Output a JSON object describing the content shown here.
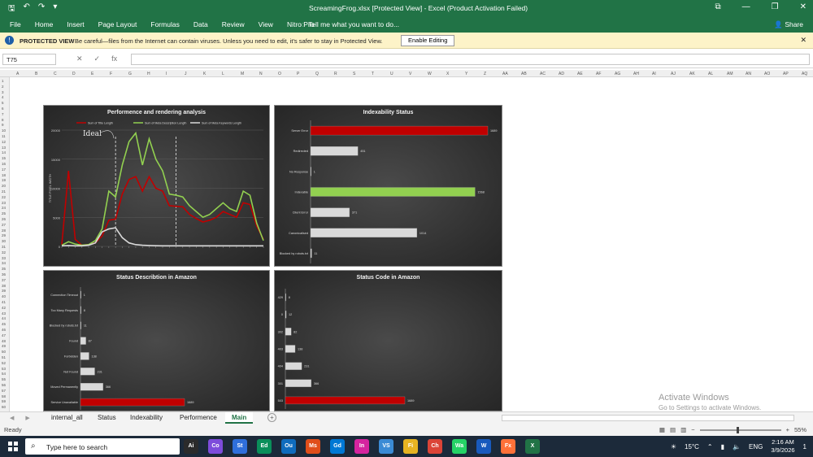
{
  "titlebar": {
    "title": "ScreamingFrog.xlsx  [Protected View]  -  Excel (Product Activation Failed)"
  },
  "ribbon": {
    "tabs": [
      "File",
      "Home",
      "Insert",
      "Page Layout",
      "Formulas",
      "Data",
      "Review",
      "View",
      "Nitro Pro"
    ],
    "tell_me": "Tell me what you want to do...",
    "share": "Share"
  },
  "protected_view": {
    "label": "PROTECTED VIEW",
    "message": "Be careful—files from the Internet can contain viruses. Unless you need to edit, it's safer to stay in Protected View.",
    "button": "Enable Editing"
  },
  "formula_bar": {
    "name_box": "T75",
    "fx": "fx",
    "formula": ""
  },
  "columns": [
    "A",
    "B",
    "C",
    "D",
    "E",
    "F",
    "G",
    "H",
    "I",
    "J",
    "K",
    "L",
    "M",
    "N",
    "O",
    "P",
    "Q",
    "R",
    "S",
    "T",
    "U",
    "V",
    "W",
    "X",
    "Y",
    "Z",
    "AA",
    "AB",
    "AC",
    "AD",
    "AE",
    "AF",
    "AG",
    "AH",
    "AI",
    "AJ",
    "AK",
    "AL",
    "AM",
    "AN",
    "AO",
    "AP",
    "AQ"
  ],
  "rows": [
    "1",
    "2",
    "3",
    "4",
    "5",
    "6",
    "7",
    "8",
    "9",
    "10",
    "11",
    "12",
    "13",
    "14",
    "15",
    "16",
    "17",
    "18",
    "19",
    "20",
    "21",
    "22",
    "23",
    "24",
    "25",
    "26",
    "27",
    "28",
    "29",
    "30",
    "31",
    "32",
    "33",
    "34",
    "35",
    "36",
    "37",
    "38",
    "39",
    "40",
    "41",
    "42",
    "43",
    "44",
    "45",
    "46",
    "47",
    "48",
    "49",
    "50",
    "51",
    "52",
    "53",
    "54",
    "55",
    "56",
    "57",
    "58",
    "59",
    "60",
    "61"
  ],
  "colors": {
    "accent": "#217346",
    "red": "#c00000",
    "green": "#92d050",
    "gray": "#d9d9d9"
  },
  "chart_data": [
    {
      "type": "line",
      "title": "Performence and rendering analysis",
      "ylabel": "TITLE PIXEL WIDTH",
      "annotation": "Ideal",
      "ylim": [
        0,
        20000
      ],
      "yticks": [
        "0",
        "5000",
        "10000",
        "15000",
        "20000"
      ],
      "series": [
        {
          "name": "Sum of Title Length",
          "color": "#c00000",
          "values": [
            300,
            13000,
            1200,
            200,
            300,
            600,
            1800,
            4500,
            4700,
            9000,
            11500,
            12000,
            9500,
            12000,
            10000,
            9500,
            7000,
            6900,
            6800,
            5500,
            4800,
            4200,
            4500,
            5000,
            6000,
            5500,
            5000,
            7500,
            7200,
            3500,
            1200
          ]
        },
        {
          "name": "Sum of Meta Description Length",
          "color": "#92d050",
          "values": [
            200,
            800,
            400,
            200,
            300,
            1000,
            3000,
            9500,
            8500,
            14000,
            18000,
            19500,
            14000,
            18500,
            15000,
            13000,
            9000,
            8800,
            8500,
            7000,
            6000,
            5000,
            5500,
            6500,
            7500,
            6500,
            6000,
            9500,
            8800,
            4000,
            1000
          ]
        },
        {
          "name": "Sum of Meta Keywords Length",
          "color": "#d9d9d9",
          "values": [
            100,
            150,
            100,
            100,
            200,
            600,
            2500,
            3000,
            3200,
            1500,
            600,
            300,
            200,
            150,
            120,
            100,
            100,
            100,
            100,
            100,
            100,
            100,
            100,
            100,
            100,
            100,
            100,
            100,
            100,
            100,
            100
          ]
        }
      ]
    },
    {
      "type": "bar",
      "title": "Indexability Status",
      "categories": [
        "Server Error",
        "Redirected",
        "No Response",
        "Indexable",
        "Client Error",
        "Canonicalised",
        "Blocked by robots.txt"
      ],
      "values": [
        1689,
        451,
        1,
        1568,
        371,
        1014,
        11
      ],
      "colors": [
        "#c00000",
        "#d9d9d9",
        "#d9d9d9",
        "#92d050",
        "#d9d9d9",
        "#d9d9d9",
        "#d9d9d9"
      ]
    },
    {
      "type": "bar",
      "title": "Status Describtion in Amazon",
      "categories": [
        "Connection Timeout",
        "Too Many Requests",
        "Blocked by robots.txt",
        "Found",
        "Forbidden",
        "Not Found",
        "Moved Permanently",
        "Service Unavailable"
      ],
      "values": [
        1,
        8,
        11,
        87,
        138,
        231,
        366,
        1689
      ],
      "colors": [
        "#d9d9d9",
        "#d9d9d9",
        "#d9d9d9",
        "#d9d9d9",
        "#d9d9d9",
        "#d9d9d9",
        "#d9d9d9",
        "#c00000"
      ]
    },
    {
      "type": "bar",
      "title": "Status Code in Amazon",
      "categories": [
        "429",
        "0",
        "302",
        "403",
        "404",
        "301",
        "503"
      ],
      "values": [
        8,
        12,
        82,
        138,
        231,
        366,
        1689
      ],
      "colors": [
        "#d9d9d9",
        "#d9d9d9",
        "#d9d9d9",
        "#d9d9d9",
        "#d9d9d9",
        "#d9d9d9",
        "#c00000"
      ]
    }
  ],
  "sheets": [
    "internal_all",
    "Status",
    "Indexability",
    "Performence",
    "Main"
  ],
  "active_sheet": "Main",
  "status": {
    "ready": "Ready",
    "zoom": "55%"
  },
  "activation": {
    "line1": "Activate Windows",
    "line2": "Go to Settings to activate Windows."
  },
  "taskbar": {
    "search_placeholder": "Type here to search",
    "apps": [
      "Ai",
      "Co",
      "St",
      "Ed",
      "Ou",
      "Ms",
      "Gd",
      "In",
      "VS",
      "Fi",
      "Ch",
      "Wa",
      "W",
      "Fx",
      "X"
    ],
    "weather": "15°C",
    "lang": "ENG",
    "time": "2:16 AM",
    "date": "3/9/2026",
    "whatsapp_badge": "20",
    "notif": "1"
  }
}
